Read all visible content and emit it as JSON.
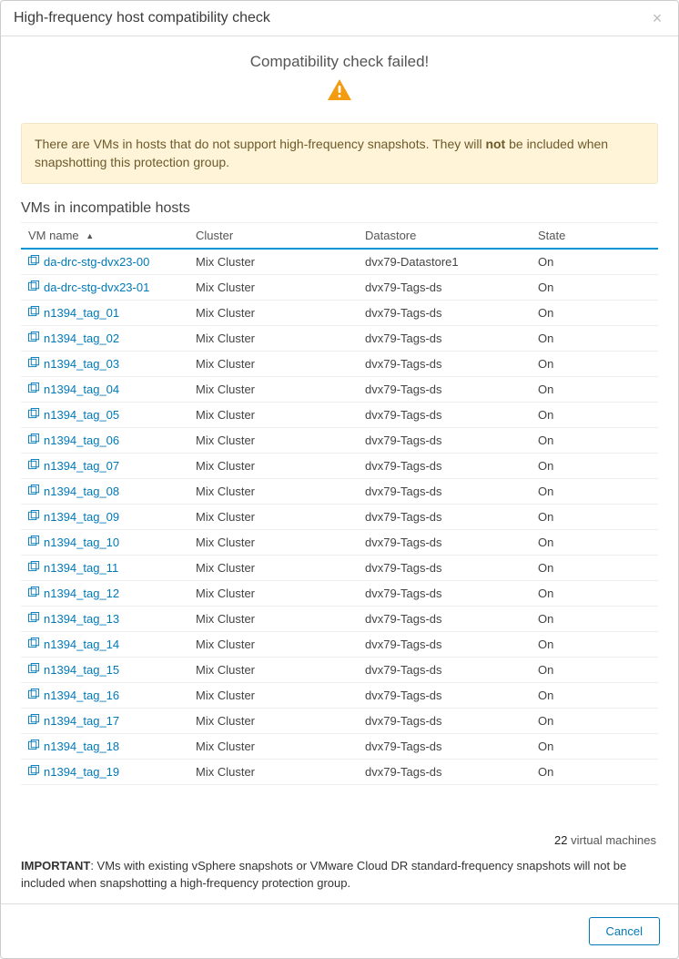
{
  "dialog": {
    "title": "High-frequency host compatibility check",
    "status_message": "Compatibility check failed!",
    "banner_prefix": "There are VMs in hosts that do not support high-frequency snapshots. They will ",
    "banner_bold": "not",
    "banner_suffix": " be included when snapshotting this protection group.",
    "section_title": "VMs in incompatible hosts",
    "columns": {
      "name": "VM name",
      "cluster": "Cluster",
      "datastore": "Datastore",
      "state": "State"
    },
    "rows": [
      {
        "name": "da-drc-stg-dvx23-00",
        "cluster": "Mix Cluster",
        "datastore": "dvx79-Datastore1",
        "state": "On"
      },
      {
        "name": "da-drc-stg-dvx23-01",
        "cluster": "Mix Cluster",
        "datastore": "dvx79-Tags-ds",
        "state": "On"
      },
      {
        "name": "n1394_tag_01",
        "cluster": "Mix Cluster",
        "datastore": "dvx79-Tags-ds",
        "state": "On"
      },
      {
        "name": "n1394_tag_02",
        "cluster": "Mix Cluster",
        "datastore": "dvx79-Tags-ds",
        "state": "On"
      },
      {
        "name": "n1394_tag_03",
        "cluster": "Mix Cluster",
        "datastore": "dvx79-Tags-ds",
        "state": "On"
      },
      {
        "name": "n1394_tag_04",
        "cluster": "Mix Cluster",
        "datastore": "dvx79-Tags-ds",
        "state": "On"
      },
      {
        "name": "n1394_tag_05",
        "cluster": "Mix Cluster",
        "datastore": "dvx79-Tags-ds",
        "state": "On"
      },
      {
        "name": "n1394_tag_06",
        "cluster": "Mix Cluster",
        "datastore": "dvx79-Tags-ds",
        "state": "On"
      },
      {
        "name": "n1394_tag_07",
        "cluster": "Mix Cluster",
        "datastore": "dvx79-Tags-ds",
        "state": "On"
      },
      {
        "name": "n1394_tag_08",
        "cluster": "Mix Cluster",
        "datastore": "dvx79-Tags-ds",
        "state": "On"
      },
      {
        "name": "n1394_tag_09",
        "cluster": "Mix Cluster",
        "datastore": "dvx79-Tags-ds",
        "state": "On"
      },
      {
        "name": "n1394_tag_10",
        "cluster": "Mix Cluster",
        "datastore": "dvx79-Tags-ds",
        "state": "On"
      },
      {
        "name": "n1394_tag_11",
        "cluster": "Mix Cluster",
        "datastore": "dvx79-Tags-ds",
        "state": "On"
      },
      {
        "name": "n1394_tag_12",
        "cluster": "Mix Cluster",
        "datastore": "dvx79-Tags-ds",
        "state": "On"
      },
      {
        "name": "n1394_tag_13",
        "cluster": "Mix Cluster",
        "datastore": "dvx79-Tags-ds",
        "state": "On"
      },
      {
        "name": "n1394_tag_14",
        "cluster": "Mix Cluster",
        "datastore": "dvx79-Tags-ds",
        "state": "On"
      },
      {
        "name": "n1394_tag_15",
        "cluster": "Mix Cluster",
        "datastore": "dvx79-Tags-ds",
        "state": "On"
      },
      {
        "name": "n1394_tag_16",
        "cluster": "Mix Cluster",
        "datastore": "dvx79-Tags-ds",
        "state": "On"
      },
      {
        "name": "n1394_tag_17",
        "cluster": "Mix Cluster",
        "datastore": "dvx79-Tags-ds",
        "state": "On"
      },
      {
        "name": "n1394_tag_18",
        "cluster": "Mix Cluster",
        "datastore": "dvx79-Tags-ds",
        "state": "On"
      },
      {
        "name": "n1394_tag_19",
        "cluster": "Mix Cluster",
        "datastore": "dvx79-Tags-ds",
        "state": "On"
      }
    ],
    "footer_count": "22",
    "footer_unit": " virtual machines",
    "important_label": "IMPORTANT",
    "important_text": ": VMs with existing vSphere snapshots or VMware Cloud DR standard-frequency snapshots will not be included when snapshotting a high-frequency protection group.",
    "cancel_label": "Cancel"
  }
}
